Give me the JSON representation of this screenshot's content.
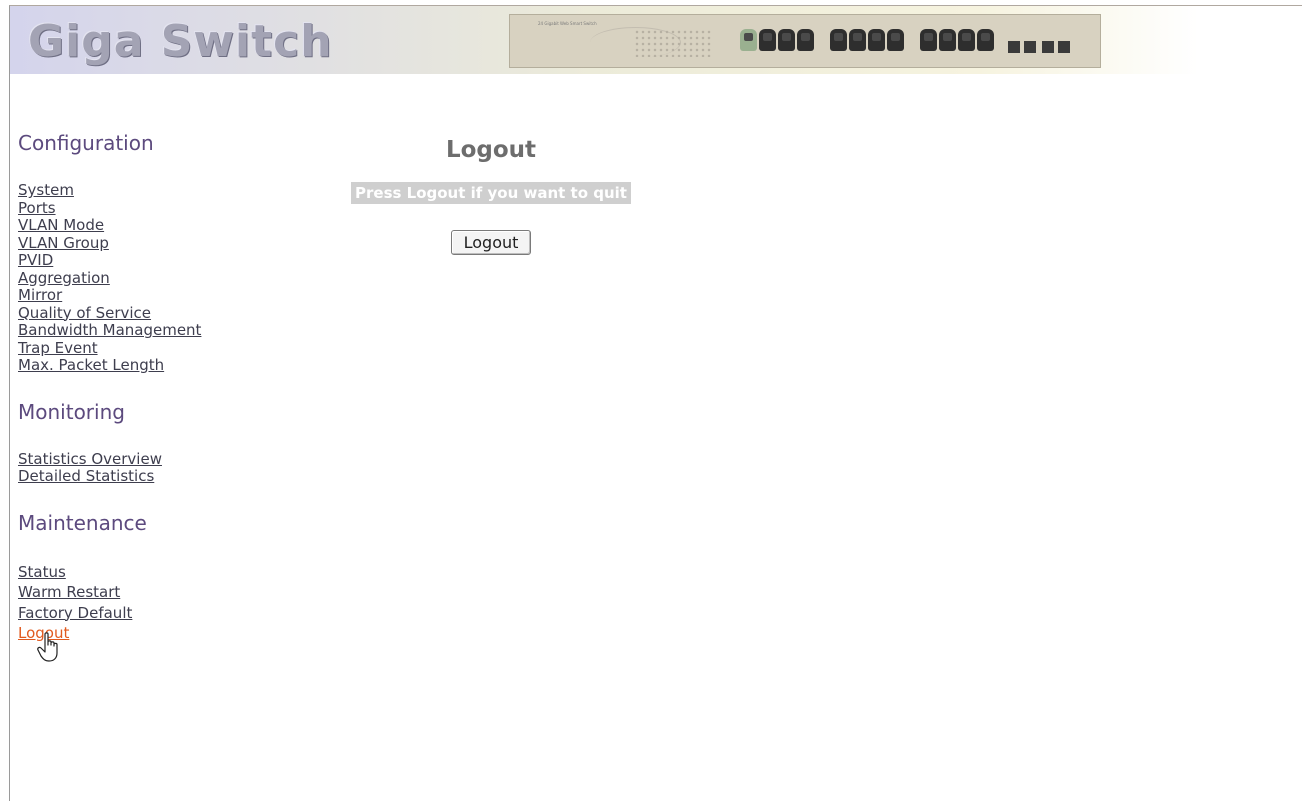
{
  "header": {
    "brand": "Giga Switch",
    "device_label": "24 Gigabit Web Smart Switch"
  },
  "sidebar": {
    "sections": [
      {
        "title": "Configuration",
        "links": [
          "System",
          "Ports",
          "VLAN Mode",
          "VLAN Group",
          "PVID",
          "Aggregation",
          "Mirror",
          "Quality of Service",
          "Bandwidth Management",
          "Trap Event",
          "Max. Packet Length"
        ]
      },
      {
        "title": "Monitoring",
        "links": [
          "Statistics Overview",
          "Detailed Statistics"
        ]
      },
      {
        "title": "Maintenance",
        "links": [
          "Status",
          "Warm Restart",
          "Factory Default",
          "Logout"
        ]
      }
    ],
    "active_link": "Logout"
  },
  "main": {
    "title": "Logout",
    "message": "Press Logout if you want to quit",
    "button_label": "Logout"
  },
  "colors": {
    "section_title": "#5c4a7e",
    "link": "#3e3e4e",
    "active_link": "#e15a1f",
    "message_bg": "#cfcfcf"
  },
  "icons": [
    "hand-cursor-icon"
  ]
}
